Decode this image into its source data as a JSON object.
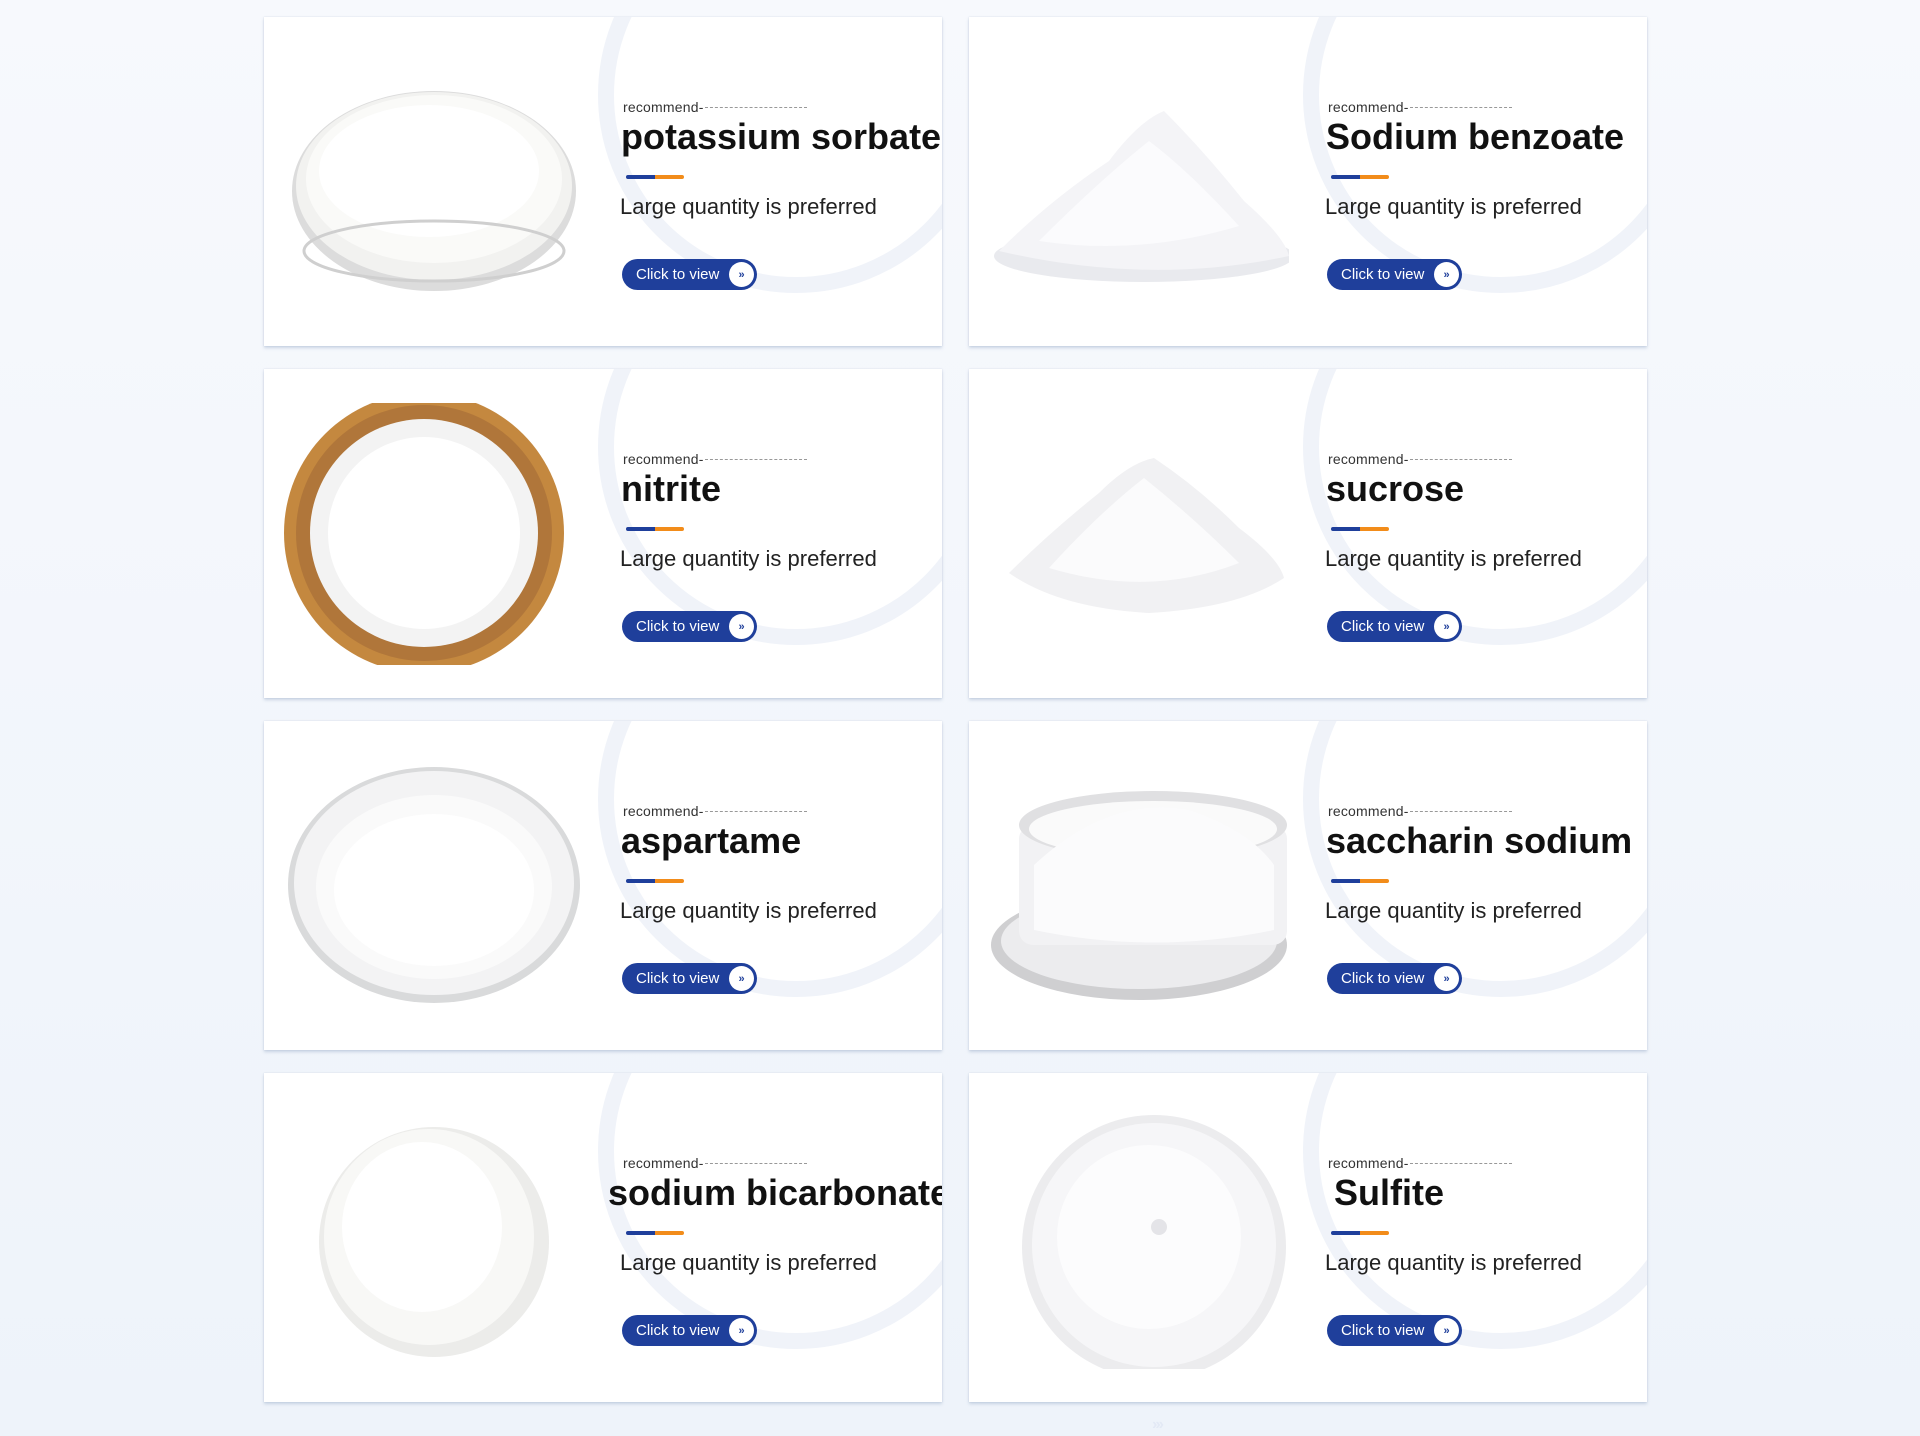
{
  "products": [
    {
      "recommend": "recommend-",
      "name": "potassium sorbate",
      "subtitle": "Large quantity is preferred",
      "button": "Click to view",
      "button_icon": "»",
      "image": "powder-in-petri-dish"
    },
    {
      "recommend": "recommend-",
      "name": "Sodium benzoate",
      "subtitle": "Large quantity is preferred",
      "button": "Click to view",
      "button_icon": "»",
      "image": "crystal-powder-pile"
    },
    {
      "recommend": "recommend-",
      "name": "nitrite",
      "subtitle": "Large quantity is preferred",
      "button": "Click to view",
      "button_icon": "»",
      "image": "crystals-in-wooden-bowl"
    },
    {
      "recommend": "recommend-",
      "name": "sucrose",
      "subtitle": "Large quantity is preferred",
      "button": "Click to view",
      "button_icon": "»",
      "image": "sugar-pile"
    },
    {
      "recommend": "recommend-",
      "name": "aspartame",
      "subtitle": "Large quantity is preferred",
      "button": "Click to view",
      "button_icon": "»",
      "image": "powder-on-white-plate"
    },
    {
      "recommend": "recommend-",
      "name": "saccharin sodium",
      "subtitle": "Large quantity is preferred",
      "button": "Click to view",
      "button_icon": "»",
      "image": "crystals-in-glass-dish"
    },
    {
      "recommend": "recommend-",
      "name": "sodium bicarbonate",
      "subtitle": "Large quantity is preferred",
      "button": "Click to view",
      "button_icon": "»",
      "image": "white-powder-mound"
    },
    {
      "recommend": "recommend-",
      "name": "Sulfite",
      "subtitle": "Large quantity is preferred",
      "button": "Click to view",
      "button_icon": "»",
      "image": "powder-mound-top-view"
    }
  ],
  "pager_hint": "›››",
  "colors": {
    "accent_blue": "#1f3f9b",
    "accent_orange": "#f28c1a"
  }
}
